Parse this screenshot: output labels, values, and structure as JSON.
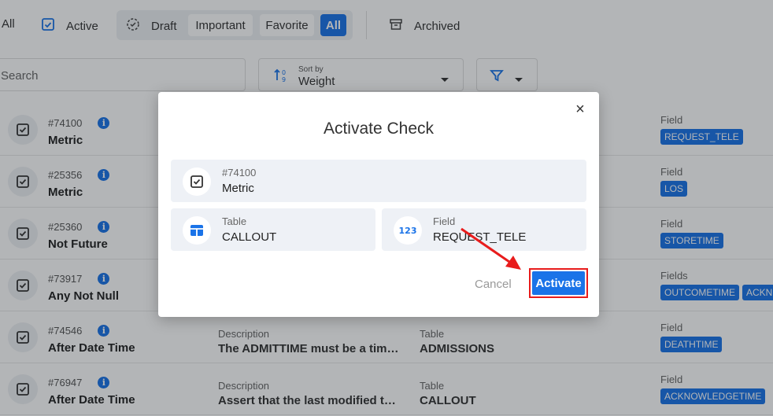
{
  "filters": {
    "all_label": "All",
    "active_label": "Active",
    "draft_label": "Draft",
    "important_label": "Important",
    "favorite_label": "Favorite",
    "group_all_label": "All",
    "archived_label": "Archived"
  },
  "search": {
    "placeholder": "Search"
  },
  "sort": {
    "caption": "Sort by",
    "value": "Weight"
  },
  "rows": [
    {
      "id": "#74100",
      "type": "Metric",
      "desc_caption": "",
      "desc": "",
      "table_caption": "",
      "table": "",
      "field_caption": "Field",
      "tags": [
        "REQUEST_TELE"
      ]
    },
    {
      "id": "#25356",
      "type": "Metric",
      "desc_caption": "",
      "desc": "",
      "table_caption": "",
      "table": "",
      "field_caption": "Field",
      "tags": [
        "LOS"
      ]
    },
    {
      "id": "#25360",
      "type": "Not Future",
      "desc_caption": "",
      "desc": "",
      "table_caption": "",
      "table": "",
      "field_caption": "Field",
      "tags": [
        "STORETIME"
      ]
    },
    {
      "id": "#73917",
      "type": "Any Not Null",
      "desc_caption": "",
      "desc": "",
      "table_caption": "",
      "table": "",
      "field_caption": "Fields",
      "tags": [
        "OUTCOMETIME",
        "ACKN"
      ]
    },
    {
      "id": "#74546",
      "type": "After Date Time",
      "desc_caption": "Description",
      "desc": "The ADMITTIME must be a timest...",
      "table_caption": "Table",
      "table": "ADMISSIONS",
      "field_caption": "Field",
      "tags": [
        "DEATHTIME"
      ]
    },
    {
      "id": "#76947",
      "type": "After Date Time",
      "desc_caption": "Description",
      "desc": "Assert that the last modified time...",
      "table_caption": "Table",
      "table": "CALLOUT",
      "field_caption": "Field",
      "tags": [
        "ACKNOWLEDGETIME"
      ]
    }
  ],
  "modal": {
    "title": "Activate Check",
    "check_id": "#74100",
    "check_type": "Metric",
    "table_caption": "Table",
    "table_value": "CALLOUT",
    "field_caption": "Field",
    "field_value": "REQUEST_TELE",
    "field_icon_text": "123",
    "cancel_label": "Cancel",
    "activate_label": "Activate",
    "close_glyph": "×"
  },
  "colors": {
    "accent": "#1a73e8",
    "highlight": "#e81c1c"
  }
}
